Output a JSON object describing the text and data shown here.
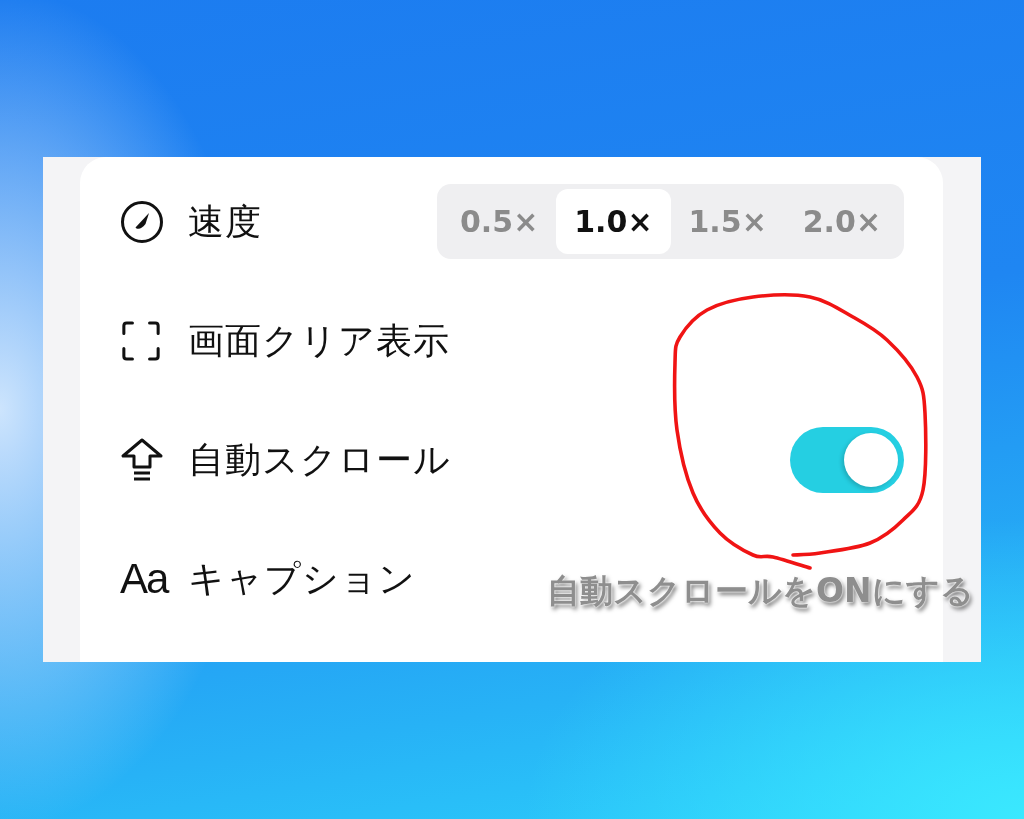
{
  "settings": [
    {
      "kind": "segmented",
      "label": "速度",
      "options": [
        {
          "label": "0.5×",
          "selected": false
        },
        {
          "label": "1.0×",
          "selected": true
        },
        {
          "label": "1.5×",
          "selected": false
        },
        {
          "label": "2.0×",
          "selected": false
        }
      ]
    },
    {
      "kind": "plain",
      "label": "画面クリア表示"
    },
    {
      "kind": "toggle",
      "label": "自動スクロール",
      "on": true
    },
    {
      "kind": "plain",
      "glyph": "Aa",
      "label": "キャプション"
    }
  ],
  "annotation": {
    "caption": "自動スクロールをONにする"
  }
}
